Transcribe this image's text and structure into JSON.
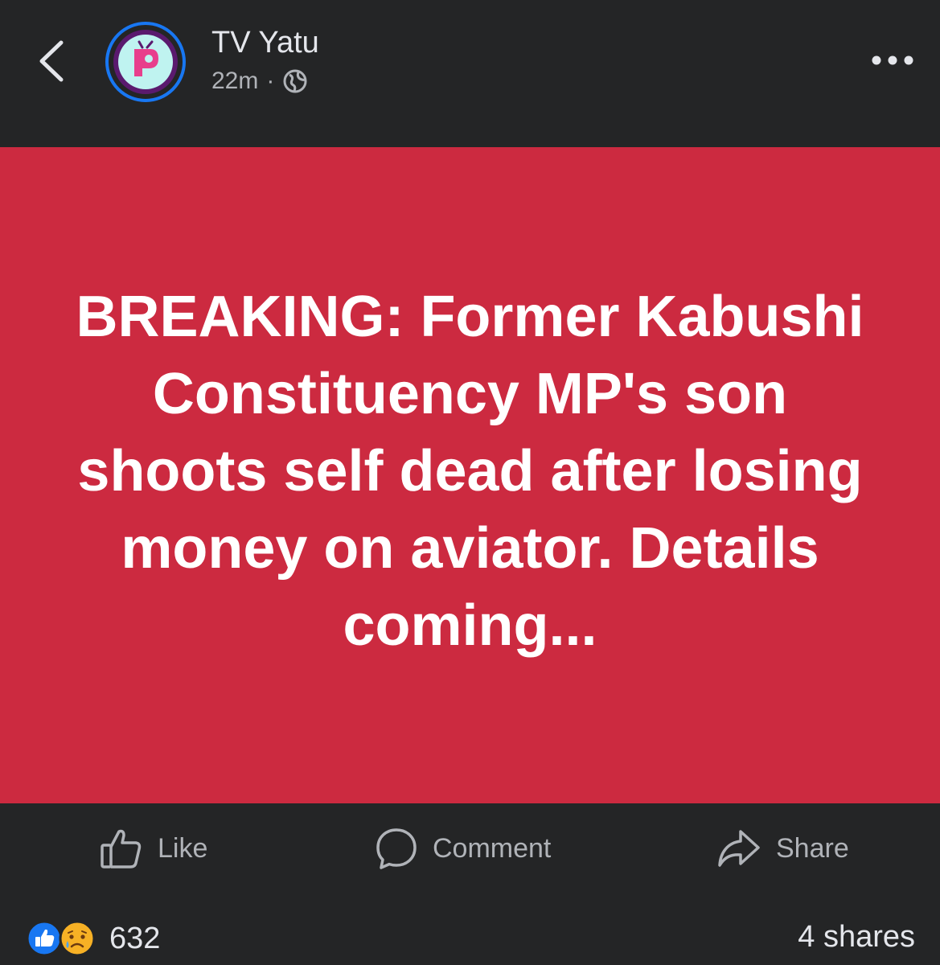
{
  "header": {
    "page_name": "TV Yatu",
    "time": "22m",
    "separator": "·",
    "audience_icon": "globe-icon"
  },
  "post": {
    "headline": "BREAKING: Former Kabushi Constituency MP's son shoots self dead after losing money on aviator. Details coming...",
    "background_color": "#cc2a40"
  },
  "actions": {
    "like_label": "Like",
    "comment_label": "Comment",
    "share_label": "Share"
  },
  "stats": {
    "reaction_icons": [
      "like-reaction-icon",
      "sad-reaction-icon"
    ],
    "reaction_count": "632",
    "shares": "4 shares"
  },
  "colors": {
    "background": "#242526",
    "accent": "#1877f2",
    "text": "#e4e6eb",
    "muted": "#b0b3b8"
  }
}
